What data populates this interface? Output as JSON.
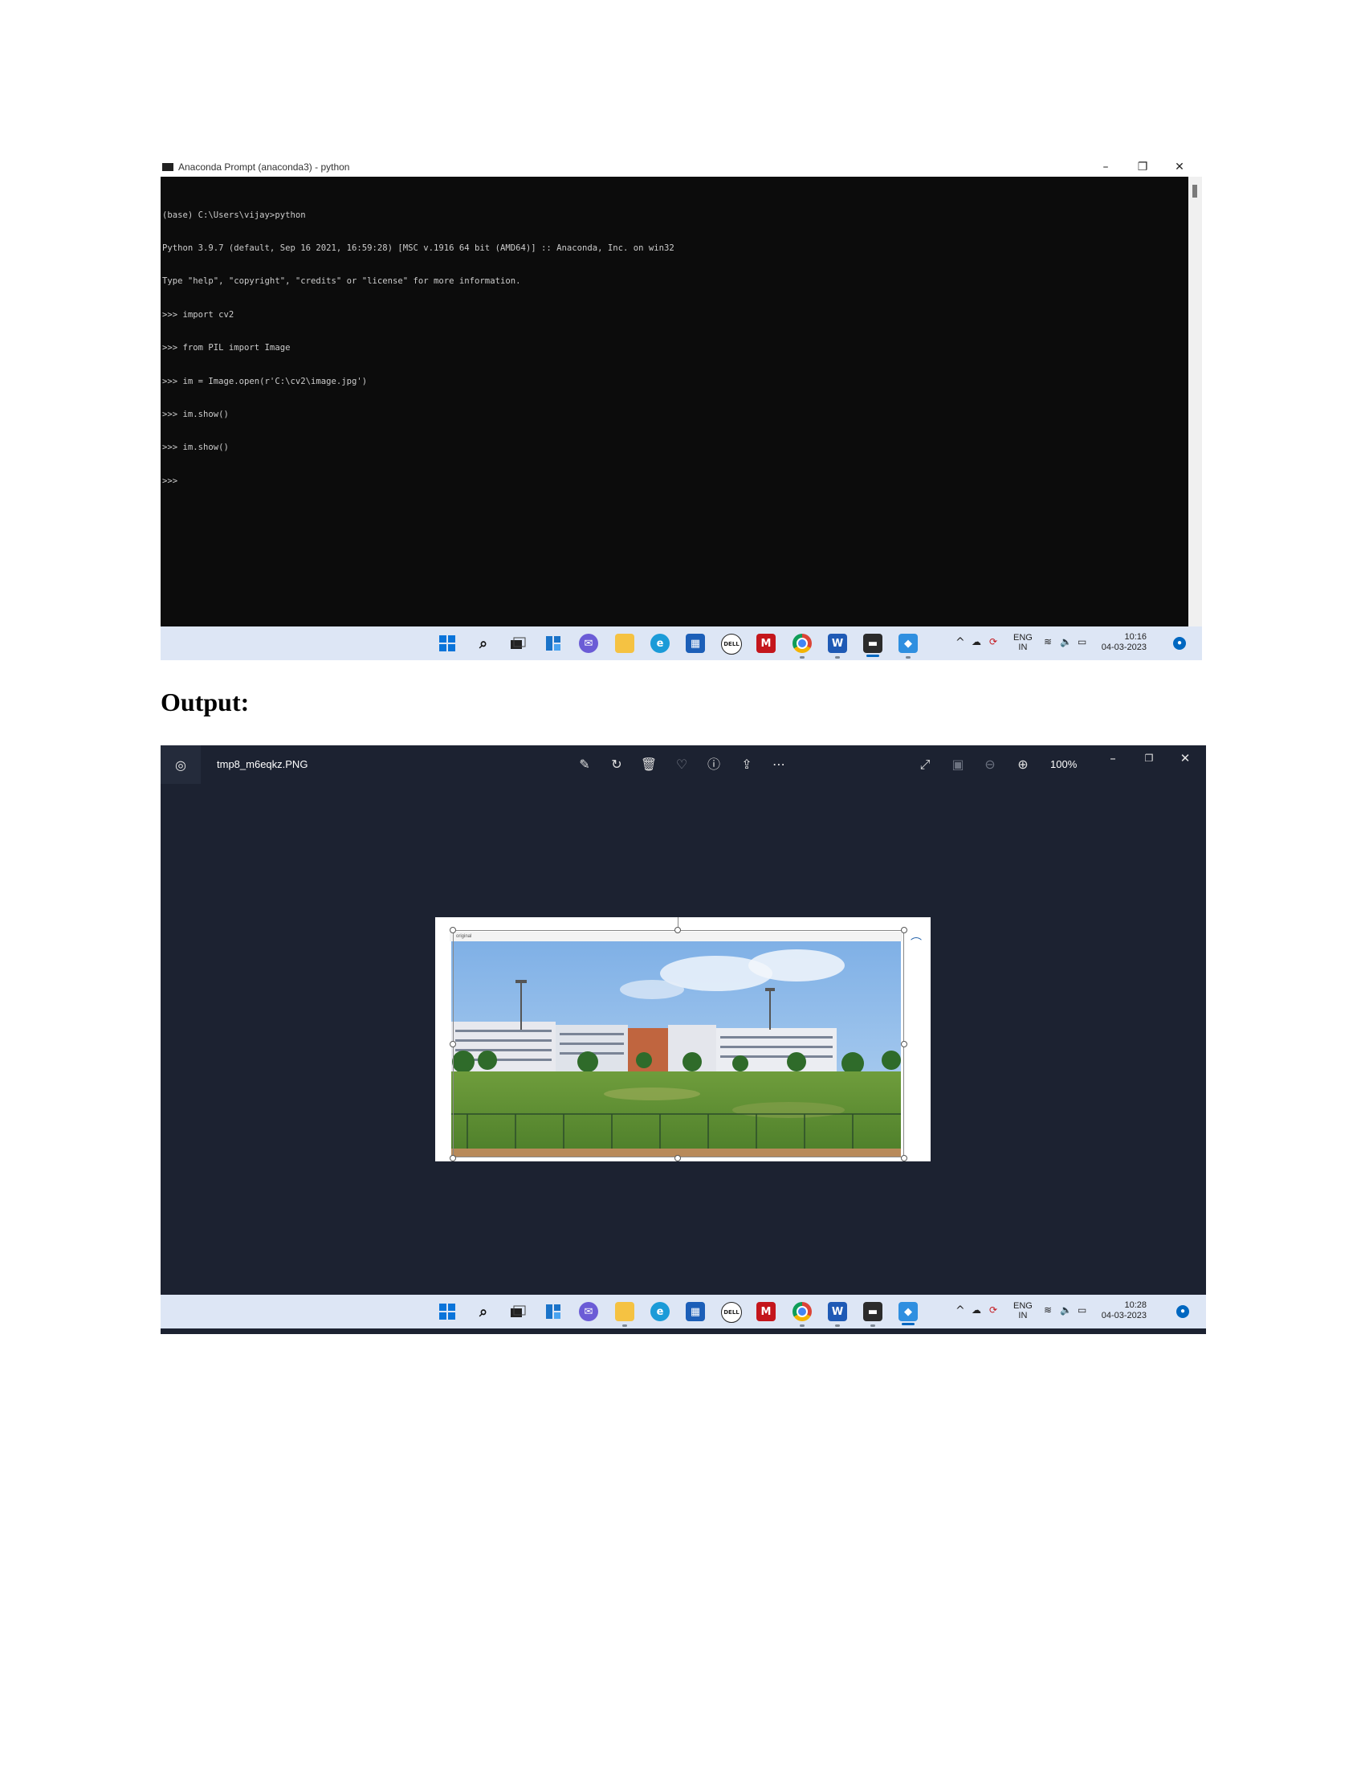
{
  "terminal": {
    "title": "Anaconda Prompt (anaconda3) - python",
    "lines": [
      "(base) C:\\Users\\vijay>python",
      "Python 3.9.7 (default, Sep 16 2021, 16:59:28) [MSC v.1916 64 bit (AMD64)] :: Anaconda, Inc. on win32",
      "Type \"help\", \"copyright\", \"credits\" or \"license\" for more information.",
      ">>> import cv2",
      ">>> from PIL import Image",
      ">>> im = Image.open(r'C:\\cv2\\image.jpg')",
      ">>> im.show()",
      ">>> im.show()",
      ">>>"
    ]
  },
  "window_controls": {
    "minimize": "–",
    "restore": "❐",
    "close": "✕"
  },
  "taskbar1": {
    "tray_chevron": "^",
    "lang_top": "ENG",
    "lang_bottom": "IN",
    "time": "10:16",
    "date": "04-03-2023"
  },
  "output_heading": "Output:",
  "viewer": {
    "filename": "tmp8_m6eqkz.PNG",
    "zoom": "100%",
    "inner_window_title": "original",
    "tools": [
      "edit-image",
      "rotate",
      "delete",
      "favorite",
      "info",
      "share",
      "more"
    ]
  },
  "taskbar2": {
    "tray_chevron": "^",
    "lang_top": "ENG",
    "lang_bottom": "IN",
    "time": "10:28",
    "date": "04-03-2023"
  },
  "colors": {
    "terminal_bg": "#0c0c0c",
    "terminal_text": "#cccccc",
    "taskbar_bg": "#dde6f5",
    "viewer_bg": "#1c2231",
    "accent": "#0067c0"
  },
  "taskbar_icons": [
    "windows-start-icon",
    "search-icon",
    "task-view-icon",
    "widgets-icon",
    "teams-chat-icon",
    "file-explorer-icon",
    "edge-icon",
    "store-icon",
    "dell-icon",
    "mcafee-icon",
    "chrome-icon",
    "word-icon",
    "terminal-icon",
    "photos-icon"
  ]
}
